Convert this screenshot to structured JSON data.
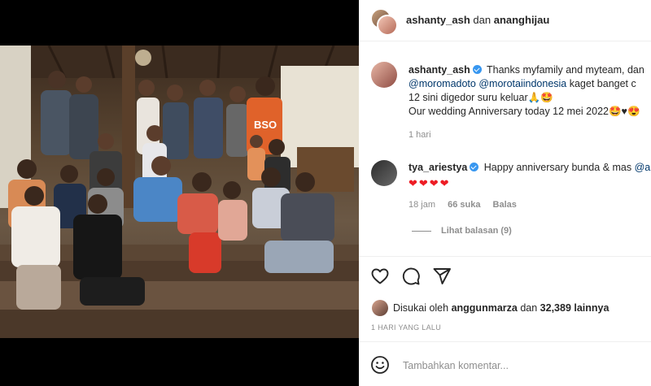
{
  "post_header": {
    "username": "ashanty_ash",
    "connector": "dan",
    "coauthor": "ananghijau"
  },
  "caption": {
    "username": "ashanty_ash",
    "line1": "Thanks myfamily and myteam, dan",
    "mention1": "@moromadoto",
    "mention2": "@morotaiindonesia",
    "line2_tail": "kaget banget c",
    "line3": "12 sini digedor suru keluar🙏🤩",
    "line4": "Our wedding Anniversary today 12 mei 2022🤩♥😍",
    "time": "1 hari"
  },
  "comment": {
    "username": "tya_ariestya",
    "text": "Happy anniversary bunda & mas",
    "mention": "@a",
    "hearts": "❤❤❤❤",
    "time": "18 jam",
    "likes": "66 suka",
    "reply_label": "Balas",
    "view_replies": "Lihat balasan (9)"
  },
  "actions": {
    "like_icon": "heart-icon",
    "comment_icon": "comment-icon",
    "share_icon": "paper-plane-icon"
  },
  "likes_line": {
    "prefix": "Disukai oleh",
    "user": "anggunmarza",
    "connector": "dan",
    "others": "32,389 lainnya"
  },
  "post_date": "1 HARI YANG LALU",
  "add_comment": {
    "placeholder": "Tambahkan komentar..."
  },
  "colors": {
    "link": "#00376b",
    "verified": "#3897f0",
    "heart": "#ed1c24",
    "muted": "#8e8e8e"
  }
}
